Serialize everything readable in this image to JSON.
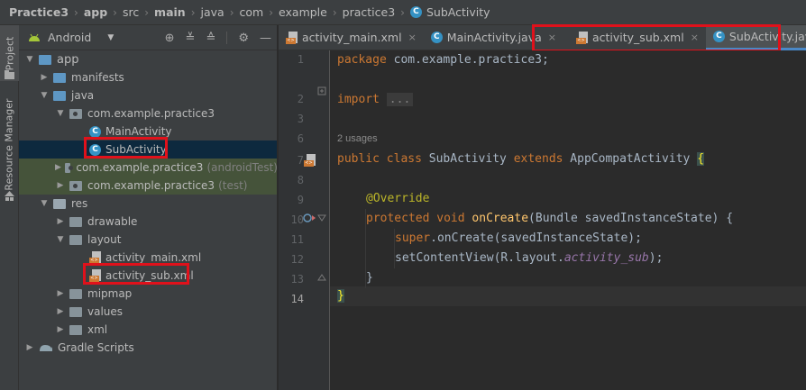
{
  "breadcrumb": {
    "items": [
      "Practice3",
      "app",
      "src",
      "main",
      "java",
      "com",
      "example",
      "practice3",
      "SubActivity"
    ],
    "class_icon": "C"
  },
  "toolstrip": {
    "project_label": "Project",
    "resource_manager_label": "Resource Manager"
  },
  "project_panel": {
    "view_label": "Android",
    "tree": {
      "app": "app",
      "manifests": "manifests",
      "java": "java",
      "pkg_main": "com.example.practice3",
      "main_activity": "MainActivity",
      "sub_activity": "SubActivity",
      "pkg_android_test": "com.example.practice3",
      "android_test_suffix": "(androidTest)",
      "pkg_test": "com.example.practice3",
      "test_suffix": "(test)",
      "res": "res",
      "drawable": "drawable",
      "layout": "layout",
      "activity_main_xml": "activity_main.xml",
      "activity_sub_xml": "activity_sub.xml",
      "mipmap": "mipmap",
      "values": "values",
      "xml": "xml",
      "gradle_scripts": "Gradle Scripts"
    }
  },
  "tabs": [
    {
      "label": "activity_main.xml",
      "close": "×"
    },
    {
      "label": "MainActivity.java",
      "close": "×"
    },
    {
      "label": "activity_sub.xml",
      "close": "×"
    },
    {
      "label": "SubActivity.java",
      "close": "×"
    }
  ],
  "editor": {
    "line_numbers": [
      "1",
      "2",
      "3",
      "6",
      "7",
      "8",
      "9",
      "10",
      "11",
      "12",
      "13",
      "14"
    ],
    "usages": "2 usages",
    "code": {
      "l1_kw": "package",
      "l1_rest": " com.example.practice3;",
      "l3_kw": "import",
      "l3_fold": "...",
      "l7_kw1": "public",
      "l7_kw2": "class",
      "l7_name": " SubActivity ",
      "l7_kw3": "extends",
      "l7_parent": " AppCompatActivity ",
      "l7_brace": "{",
      "l9_ann": "@Override",
      "l10_kw1": "protected",
      "l10_kw2": "void",
      "l10_fn": "onCreate",
      "l10_rest": "(Bundle savedInstanceState) {",
      "l11_kw": "super",
      "l11_rest": ".onCreate(savedInstanceState);",
      "l12_a": "setContentView(R.layout.",
      "l12_field": "activity_sub",
      "l12_b": ");",
      "l13": "}",
      "l14": "}"
    }
  },
  "colors": {
    "highlight_box": "#e0111b",
    "keyword": "#cc7832",
    "annotation": "#bbb529",
    "method": "#ffc66d",
    "field": "#9876aa",
    "text": "#a9b7c6"
  }
}
